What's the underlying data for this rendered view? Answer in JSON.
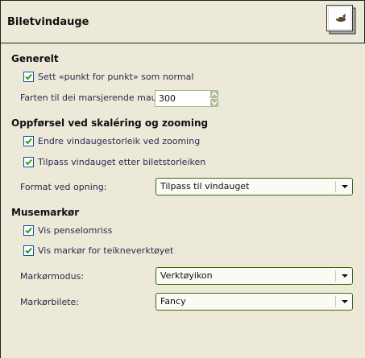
{
  "header": {
    "title": "Biletvindauge",
    "icon": "gimp-wilber-icon"
  },
  "general": {
    "heading": "Generelt",
    "dot_for_dot": {
      "label": "Sett «punkt for punkt» som normal",
      "checked": true
    },
    "ants_speed": {
      "label": "Farten til dei marsjerende maura:",
      "value": "300"
    }
  },
  "zoom": {
    "heading": "Oppførsel ved skaléring og zooming",
    "resize_on_zoom": {
      "label": "Endre vindaugestorleik ved zooming",
      "checked": true
    },
    "resize_on_image": {
      "label": "Tilpass vindauget etter biletstorleiken",
      "checked": true
    },
    "initial_zoom": {
      "label": "Format ved opning:",
      "value": "Tilpass til vindauget"
    }
  },
  "cursor": {
    "heading": "Musemarkør",
    "show_brush": {
      "label": "Vis penselomriss",
      "checked": true
    },
    "show_paint_cursor": {
      "label": "Vis markør for teikneverktøyet",
      "checked": true
    },
    "mode": {
      "label": "Markørmodus:",
      "value": "Verktøyikon"
    },
    "rendering": {
      "label": "Markørbilete:",
      "value": "Fancy"
    }
  },
  "colors": {
    "check": "#21a121",
    "background": "#ece9d8"
  }
}
